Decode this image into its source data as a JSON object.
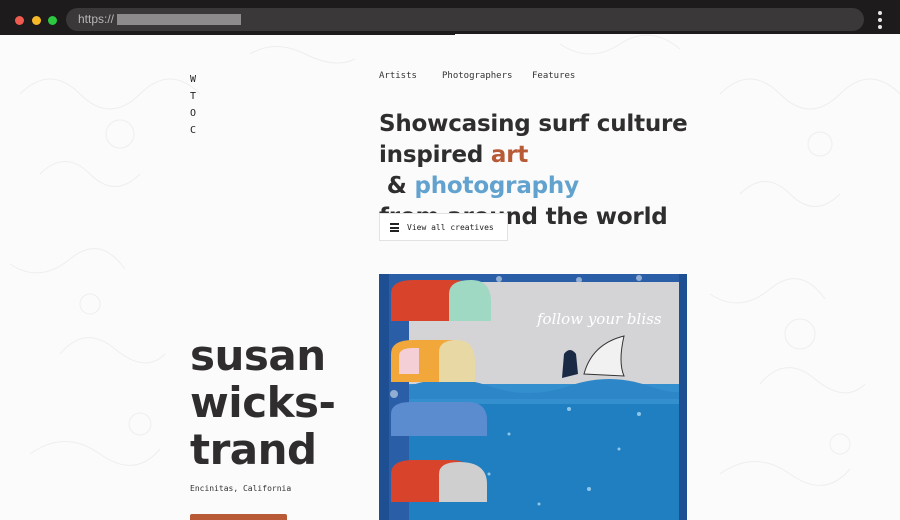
{
  "browser": {
    "url_scheme": "https://"
  },
  "site": {
    "logo_letters": [
      "W",
      "T",
      "O",
      "C"
    ]
  },
  "nav": {
    "artists": "Artists",
    "photographers": "Photographers",
    "features": "Features"
  },
  "headline": {
    "line1": "Showcasing surf culture",
    "line2_start": "inspired ",
    "art_word": "art",
    "ampersand": " & ",
    "photo_word": "photography",
    "line3": "from around the world"
  },
  "view_all": {
    "label": "View all creatives",
    "icon": "menu-icon"
  },
  "featured": {
    "name_line1": "susan",
    "name_line2": "wicks-",
    "name_line3": "trand",
    "location": "Encinitas, California",
    "artwork_text": "follow your bliss"
  },
  "colors": {
    "accent_art": "#b75a35",
    "accent_photo": "#62a2cf",
    "text": "#2f2d2e"
  }
}
